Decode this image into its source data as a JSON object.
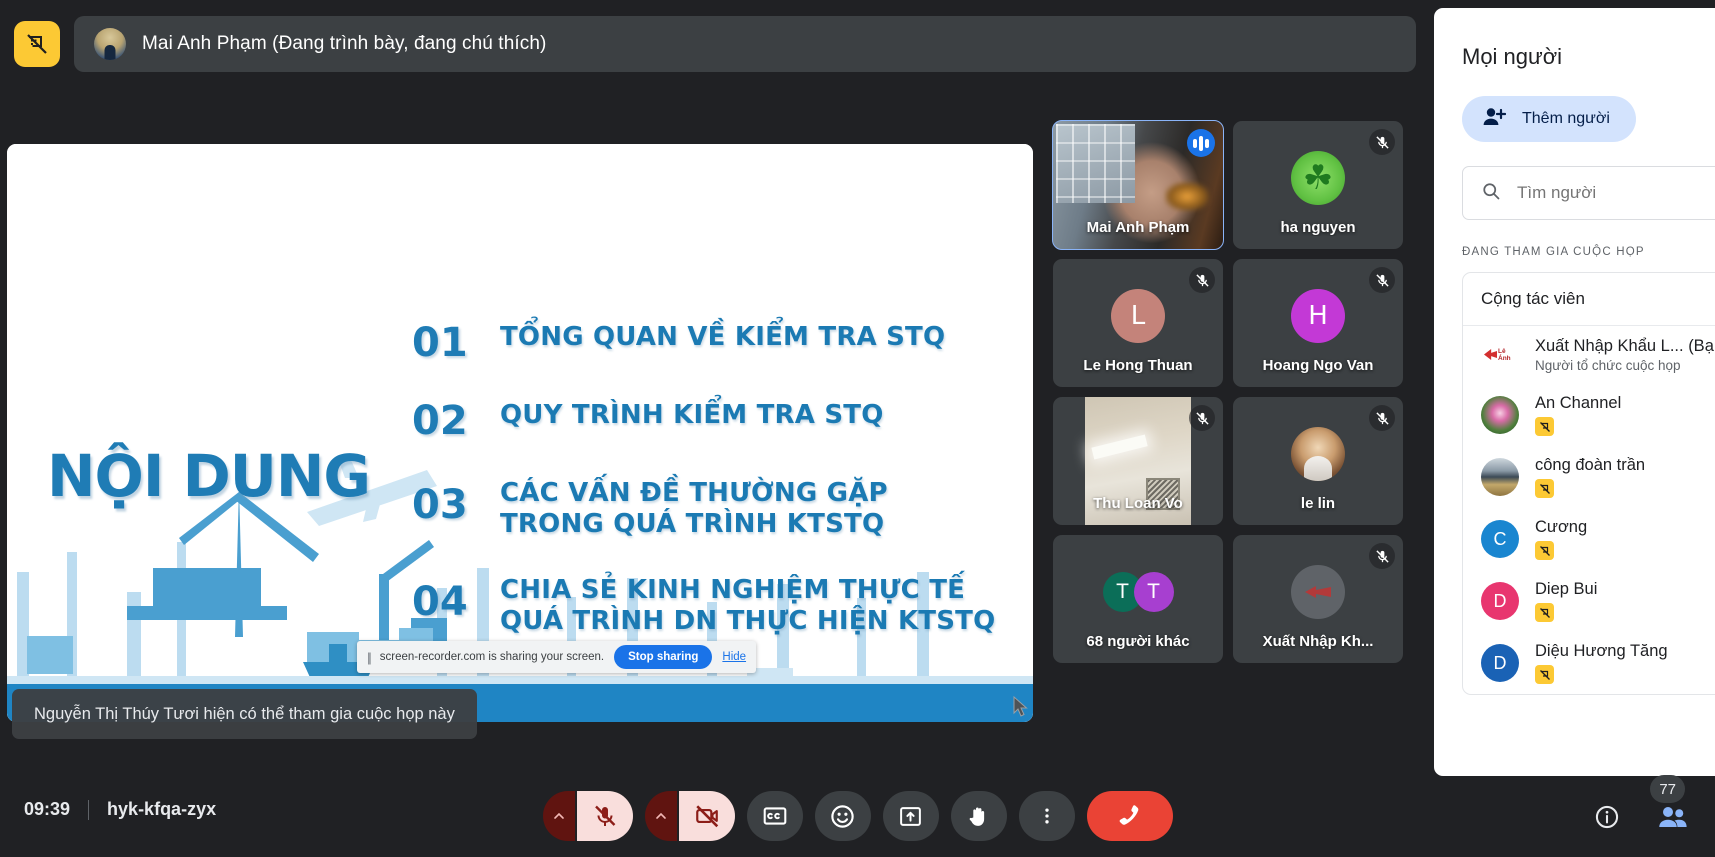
{
  "topbar": {
    "present_icon": "presentation-off-icon",
    "presenter_label": "Mai Anh Phạm (Đang trình bày, đang chú thích)"
  },
  "slide": {
    "title": "NỘI DUNG",
    "items": [
      {
        "num": "01",
        "text": "TỔNG QUAN VỀ KIỂM TRA STQ"
      },
      {
        "num": "02",
        "text": "QUY TRÌNH KIỂM TRA STQ"
      },
      {
        "num": "03",
        "text": "CÁC VẤN ĐỀ THƯỜNG GẶP\nTRONG QUÁ TRÌNH KTSTQ"
      },
      {
        "num": "04",
        "text": "CHIA SẺ KINH NGHIỆM THỰC TẾ\nQUÁ TRÌNH DN THỰC HIỆN KTSTQ"
      }
    ],
    "accent_color": "#1b7ab3"
  },
  "share_bar": {
    "message": "screen-recorder.com is sharing your screen.",
    "stop_label": "Stop sharing",
    "hide_label": "Hide"
  },
  "toast": {
    "message": "Nguyễn Thị Thúy Tươi hiện có thể tham gia cuộc họp này"
  },
  "tiles": [
    {
      "name": "Mai Anh Phạm",
      "kind": "video",
      "state": "speaking",
      "active": true
    },
    {
      "name": "ha nguyen",
      "kind": "avatar",
      "state": "muted",
      "avatar_style": "clover"
    },
    {
      "name": "Le Hong Thuan",
      "kind": "initial",
      "state": "muted",
      "initial": "L",
      "color": "#c4837a"
    },
    {
      "name": "Hoang Ngo Van",
      "kind": "initial",
      "state": "muted",
      "initial": "H",
      "color": "#c339d6"
    },
    {
      "name": "Thu Loan Vo",
      "kind": "video",
      "state": "muted"
    },
    {
      "name": "le lin",
      "kind": "avatar",
      "state": "muted",
      "avatar_style": "photo"
    },
    {
      "name": "68 người khác",
      "kind": "overflow",
      "state": "none",
      "initials": [
        "T",
        "T"
      ]
    },
    {
      "name": "Xuất Nhập Kh...",
      "kind": "logo",
      "state": "muted"
    }
  ],
  "people_panel": {
    "title": "Mọi người",
    "add_people_label": "Thêm người",
    "search_placeholder": "Tìm người",
    "section_label": "ĐANG THAM GIA CUỘC HỌP",
    "group_label": "Cộng tác viên",
    "participants": [
      {
        "name": "Xuất Nhập Khẩu L...  (Bạ",
        "sub": "Người tổ chức cuộc họp",
        "avatar": "logo-le",
        "presenting": false
      },
      {
        "name": "An Channel",
        "sub": "",
        "avatar": "lotus",
        "presenting": true
      },
      {
        "name": "công đoàn trần",
        "sub": "",
        "avatar": "mountain",
        "presenting": true
      },
      {
        "name": "Cương",
        "sub": "",
        "avatar": "initial",
        "initial": "C",
        "color": "#1a86d0",
        "presenting": true
      },
      {
        "name": "Diep Bui",
        "sub": "",
        "avatar": "initial",
        "initial": "D",
        "color": "#e8366f",
        "presenting": true
      },
      {
        "name": "Diệu Hương Tăng",
        "sub": "",
        "avatar": "initial",
        "initial": "D",
        "color": "#1a62b5",
        "presenting": true
      }
    ]
  },
  "bottombar": {
    "clock": "09:39",
    "meeting_code": "hyk-kfqa-zyx",
    "participant_count": "77",
    "controls": [
      {
        "name": "mic-options",
        "icon": "chevron-up-icon"
      },
      {
        "name": "microphone-muted",
        "icon": "mic-off-icon"
      },
      {
        "name": "camera-options",
        "icon": "chevron-up-icon"
      },
      {
        "name": "camera-off",
        "icon": "video-off-icon"
      },
      {
        "name": "captions",
        "icon": "cc-icon"
      },
      {
        "name": "reactions",
        "icon": "emoji-icon"
      },
      {
        "name": "present-now",
        "icon": "present-icon"
      },
      {
        "name": "raise-hand",
        "icon": "hand-icon"
      },
      {
        "name": "more-options",
        "icon": "more-vertical-icon"
      },
      {
        "name": "leave-call",
        "icon": "hangup-icon"
      }
    ]
  }
}
